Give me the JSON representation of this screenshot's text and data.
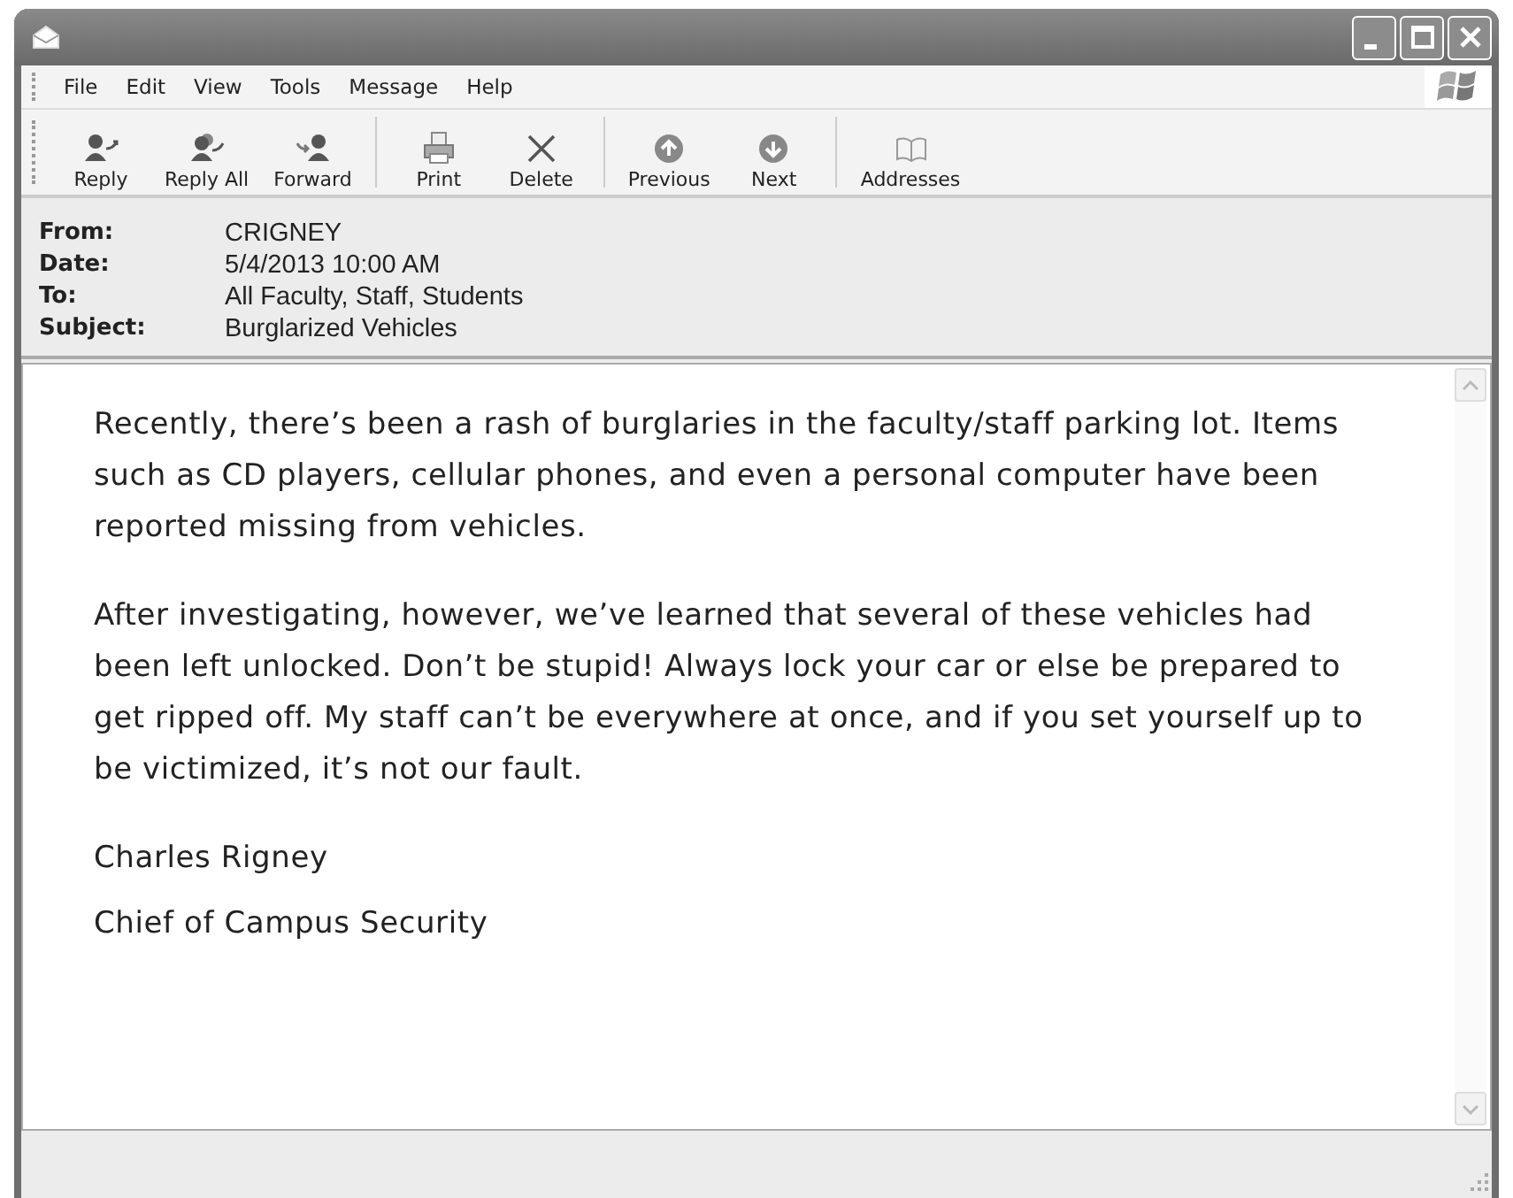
{
  "menu": [
    {
      "label": "File"
    },
    {
      "label": "Edit"
    },
    {
      "label": "View"
    },
    {
      "label": "Tools"
    },
    {
      "label": "Message"
    },
    {
      "label": "Help"
    }
  ],
  "toolbar": [
    {
      "label": "Reply",
      "separator_before": false
    },
    {
      "label": "Reply All",
      "separator_before": false
    },
    {
      "label": "Forward",
      "separator_before": false
    },
    {
      "label": "Print",
      "separator_before": true
    },
    {
      "label": "Delete",
      "separator_before": false
    },
    {
      "label": "Previous",
      "separator_before": true
    },
    {
      "label": "Next",
      "separator_before": false
    },
    {
      "label": "Addresses",
      "separator_before": true
    }
  ],
  "header": [
    {
      "label": "From:",
      "value": "CRIGNEY"
    },
    {
      "label": "Date:",
      "value": "5/4/2013 10:00 AM"
    },
    {
      "label": "To:",
      "value": "All Faculty, Staff, Students"
    },
    {
      "label": "Subject:",
      "value": "Burglarized Vehicles"
    }
  ],
  "body": {
    "paragraphs": [
      "Recently, there’s been a rash of burglaries in the faculty/staff parking lot. Items such as CD players, cellular phones, and even a personal computer have been reported missing from vehicles.",
      "After investigating, however, we’ve learned that several of these vehicles had been left unlocked. Don’t be stupid! Always lock your car or else be prepared to get ripped off. My staff can’t be everywhere at once, and if you set yourself up to be victimized, it’s not our fault."
    ],
    "signature": [
      "Charles Rigney",
      "Chief of Campus Security"
    ]
  }
}
